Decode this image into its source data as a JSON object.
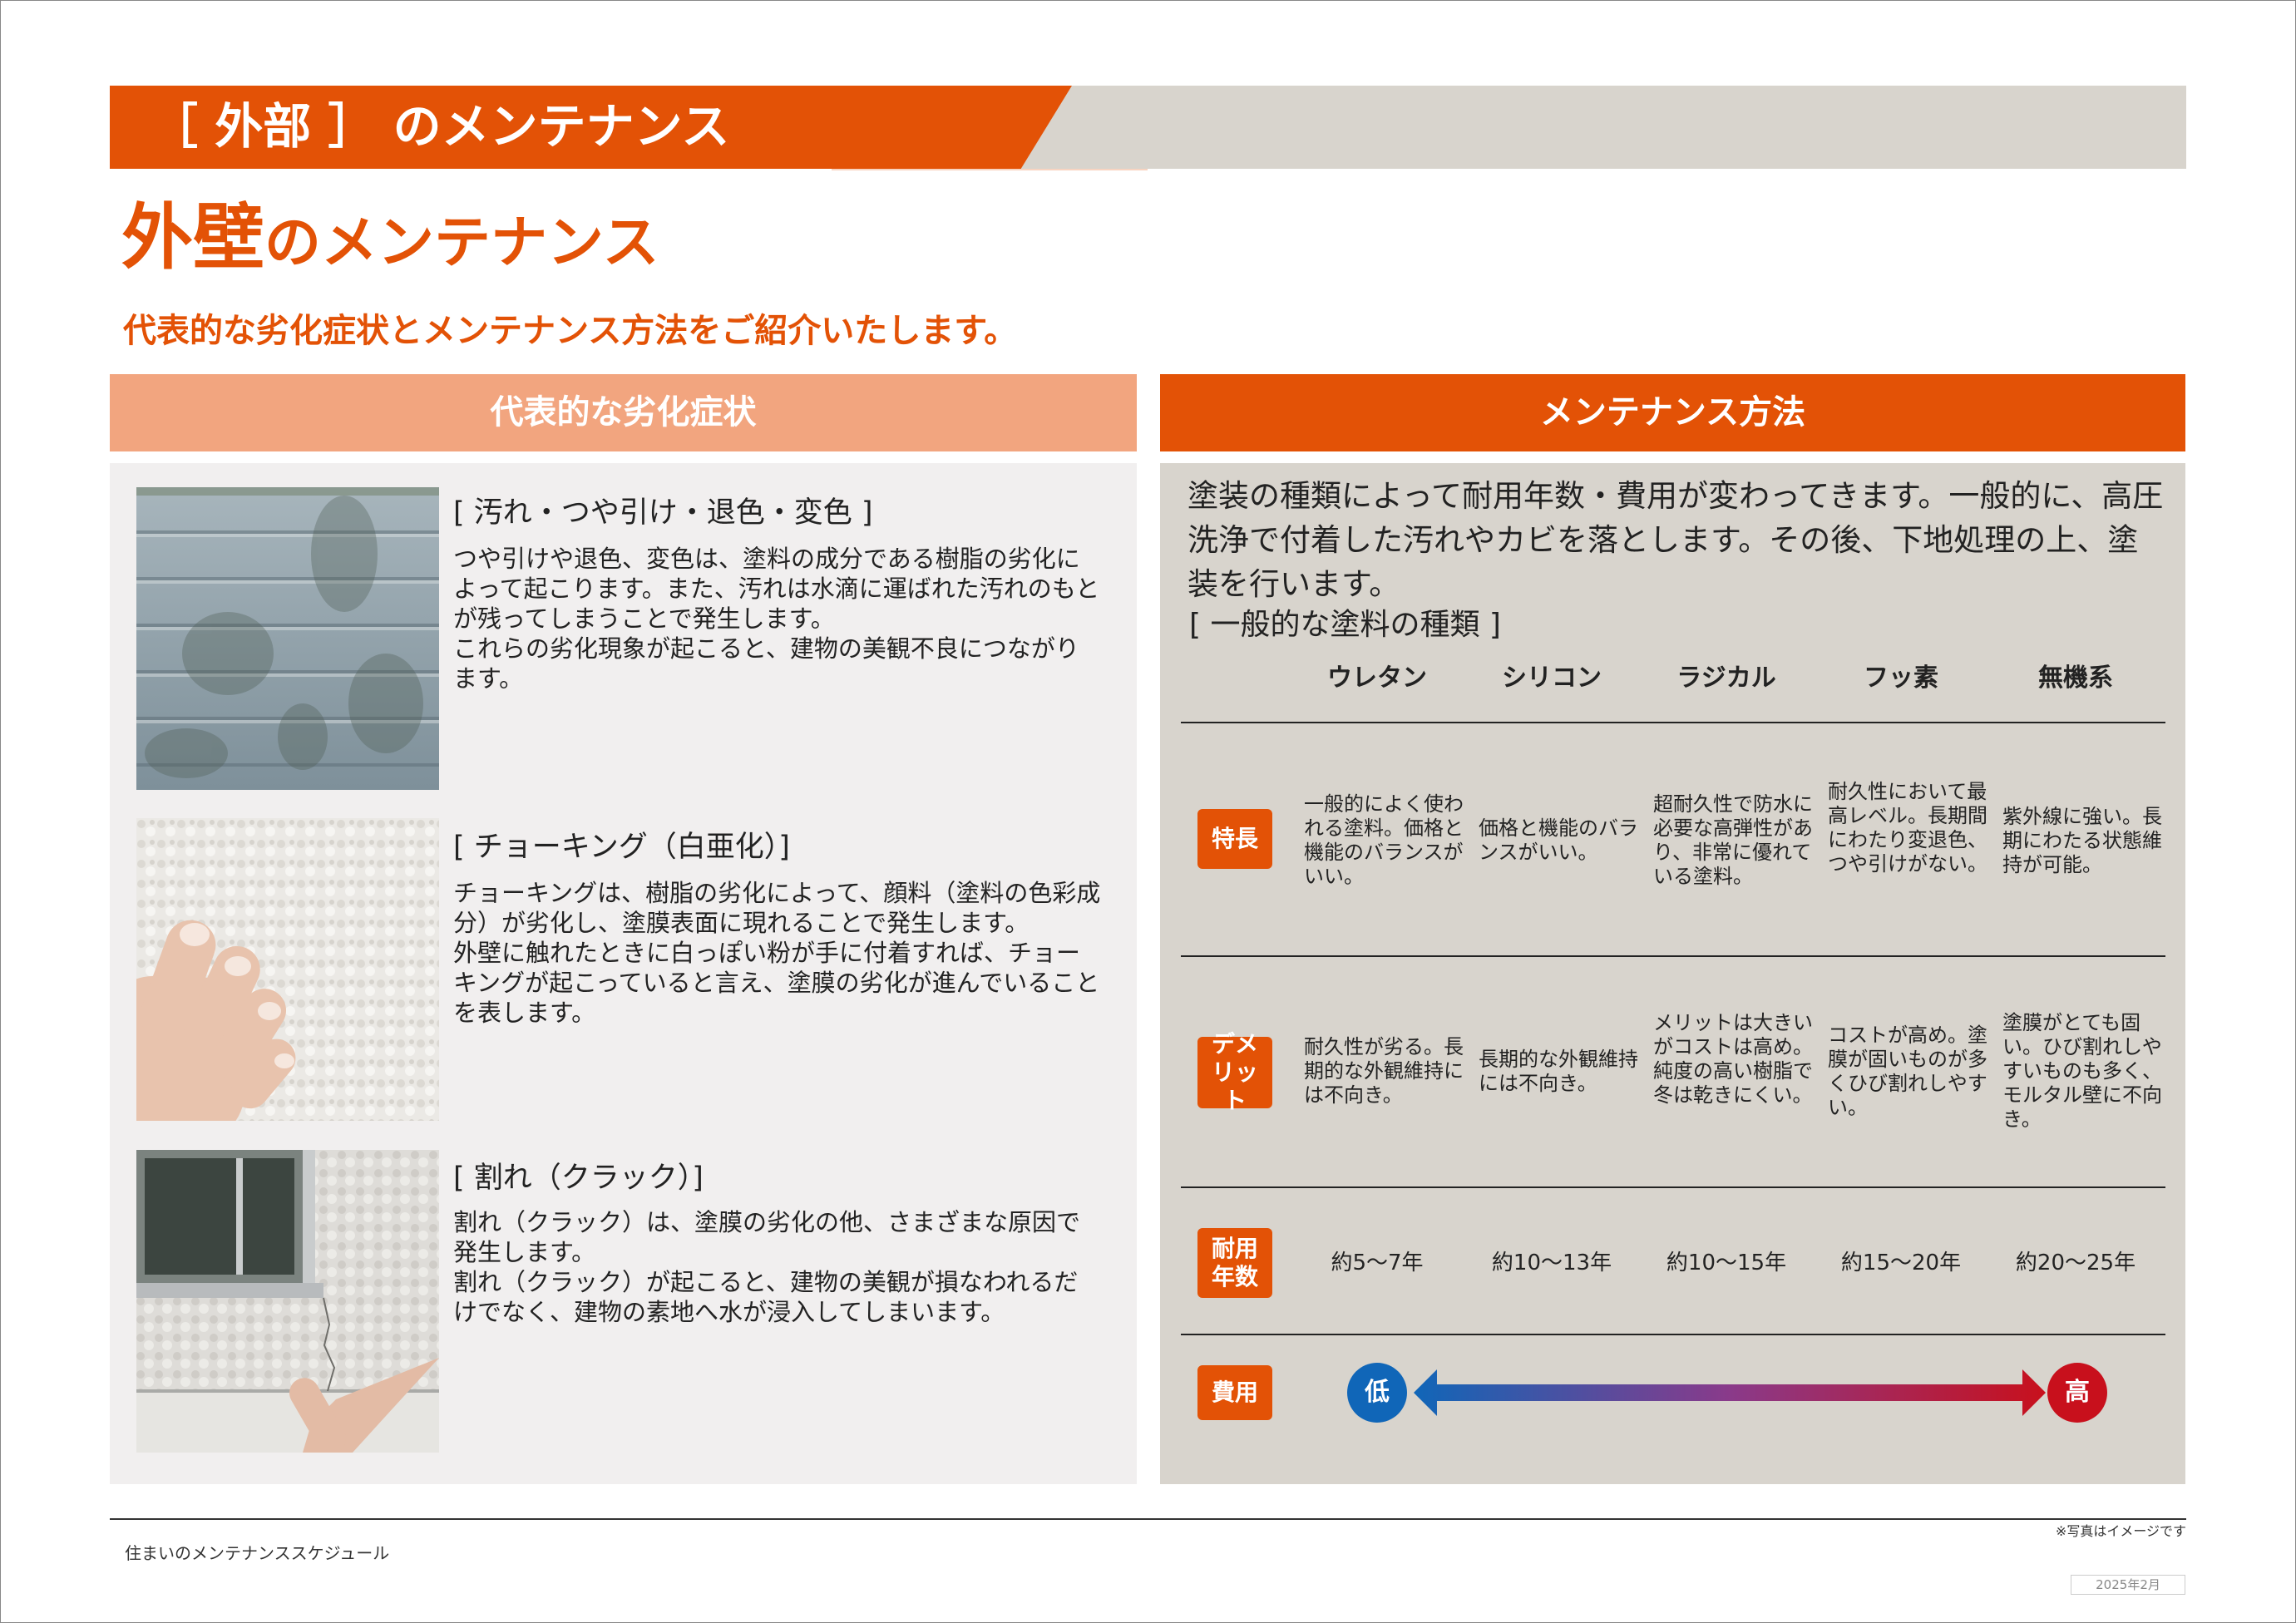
{
  "header": {
    "band_title": "［ 外部 ］ のメンテナンス",
    "page_title_big": "外壁",
    "page_title_small": "のメンテナンス",
    "lead": "代表的な劣化症状とメンテナンス方法をご紹介いたします。"
  },
  "left": {
    "heading": "代表的な劣化症状",
    "symptoms": [
      {
        "title": "[ 汚れ・つや引け・退色・変色 ]",
        "body": "つや引けや退色、変色は、塗料の成分である樹脂の劣化によって起こります。また、汚れは水滴に運ばれた汚れのもとが残ってしまうことで発生します。\nこれらの劣化現象が起こると、建物の美観不良につながります。"
      },
      {
        "title": "[ チョーキング（白亜化）]",
        "body": "チョーキングは、樹脂の劣化によって、顔料（塗料の色彩成分）が劣化し、塗膜表面に現れることで発生します。\n外壁に触れたときに白っぽい粉が手に付着すれば、チョーキングが起こっていると言え、塗膜の劣化が進んでいることを表します。"
      },
      {
        "title": "[ 割れ（クラック）]",
        "body": "割れ（クラック）は、塗膜の劣化の他、さまざまな原因で発生します。\n割れ（クラック）が起こると、建物の美観が損なわれるだけでなく、建物の素地へ水が浸入してしまいます。"
      }
    ]
  },
  "right": {
    "heading": "メンテナンス方法",
    "intro": "塗装の種類によって耐用年数・費用が変わってきます。一般的に、高圧洗浄で付着した汚れやカビを落とします。その後、下地処理の上、塗装を行います。",
    "types_title": "[ 一般的な塗料の種類 ]",
    "columns": [
      "ウレタン",
      "シリコン",
      "ラジカル",
      "フッ素",
      "無機系"
    ],
    "row_labels": {
      "features": "特長",
      "demerits": "デメリット",
      "durability": "耐用年数",
      "cost": "費用"
    },
    "features": [
      "一般的によく使われる塗料。価格と機能のバランスがいい。",
      "価格と機能のバランスがいい。",
      "超耐久性で防水に必要な高弾性があり、非常に優れている塗料。",
      "耐久性において最高レベル。長期間にわたり変退色、つや引けがない。",
      "紫外線に強い。長期にわたる状態維持が可能。"
    ],
    "demerits": [
      "耐久性が劣る。長期的な外観維持には不向き。",
      "長期的な外観維持には不向き。",
      "メリットは大きいがコストは高め。純度の高い樹脂で冬は乾きにくい。",
      "コストが高め。塗膜が固いものが多くひび割れしやすい。",
      "塗膜がとても固い。ひび割れしやすいものも多く、モルタル壁に不向き。"
    ],
    "durability": [
      "約5～7年",
      "約10～13年",
      "約10～15年",
      "約15～20年",
      "約20～25年"
    ],
    "cost_low": "低",
    "cost_high": "高",
    "colors": {
      "low": "#1066b8",
      "high": "#c8101c",
      "accent": "#e35206"
    }
  },
  "footer": {
    "left": "住まいのメンテナンススケジュール",
    "note": "※写真はイメージです",
    "date": "2025年2月"
  }
}
